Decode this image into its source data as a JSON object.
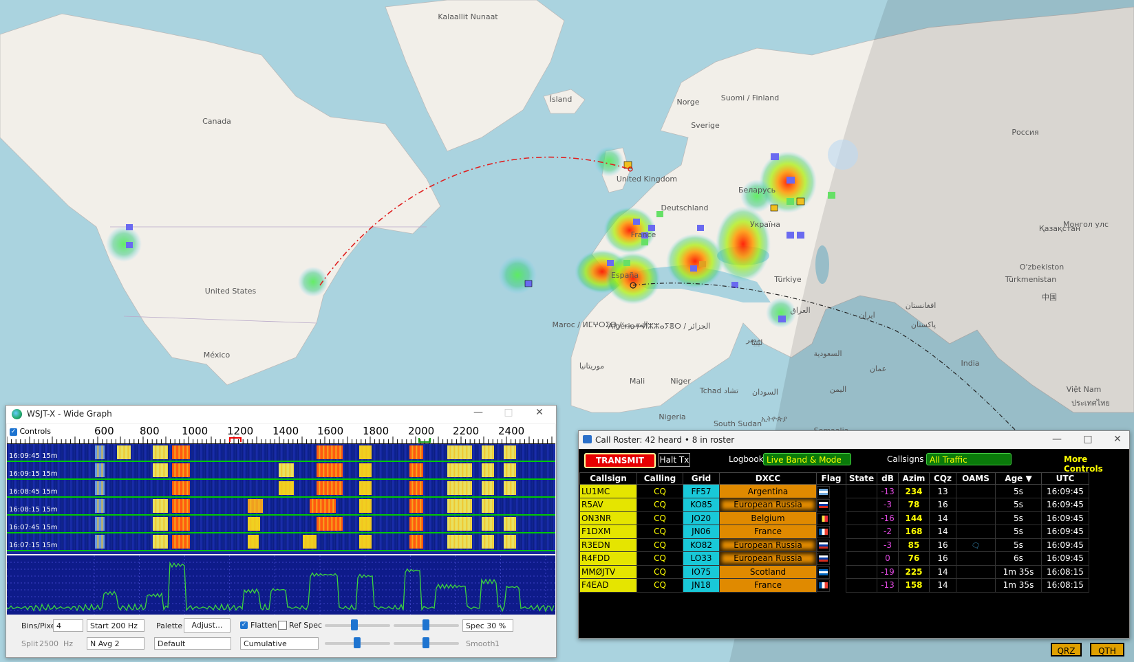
{
  "map": {
    "labels": [
      "Kalaallit Nunaat",
      "Ísland",
      "Canada",
      "Norge",
      "Suomi / Finland",
      "Sverige",
      "Россия",
      "United Kingdom",
      "Беларусь",
      "Deutschland",
      "Україна",
      "Қазақстан",
      "Монгол улс",
      "United States",
      "France",
      "España",
      "Türkiye",
      "O'zbekiston",
      "Türkmenistan",
      "Maroc / ⵍⵎⵖⵔⵉⴱ / المغرب",
      "Algérie / ⵍⵣⵣⴰⵢⴻⵔ / الجزائر",
      "ليبيا",
      "مصر",
      "العراق",
      "ایران",
      "افغانستان",
      "پاکستان",
      "India",
      "中国",
      "México",
      "موريتانيا",
      "Mali",
      "Niger",
      "Tchad تشاد",
      "السودان",
      "السعودية",
      "اليمن",
      "عمان",
      "Nigeria",
      "South Sudan",
      "ኢትዮጵያ",
      "Somaalia",
      "Việt Nam",
      "ประเทศไทย"
    ]
  },
  "widegraph": {
    "title": "WSJT-X - Wide Graph",
    "controls_label": "Controls",
    "scale": [
      "600",
      "800",
      "1000",
      "1200",
      "1400",
      "1600",
      "1800",
      "2000",
      "2200",
      "2400"
    ],
    "rows": [
      {
        "time": "16:09:45",
        "band": "15m"
      },
      {
        "time": "16:09:15",
        "band": "15m"
      },
      {
        "time": "16:08:45",
        "band": "15m"
      },
      {
        "time": "16:08:15",
        "band": "15m"
      },
      {
        "time": "16:07:45",
        "band": "15m"
      },
      {
        "time": "16:07:15",
        "band": "15m"
      }
    ],
    "bins_pixel_label": "Bins/Pixel",
    "bins_pixel_value": "4",
    "start_value": "Start 200 Hz",
    "split_label": "Split",
    "split_value": "2500",
    "split_unit": "Hz",
    "navg_value": "N Avg 2",
    "palette_label": "Palette",
    "adjust_label": "Adjust...",
    "palette_value": "Default",
    "flatten_label": "Flatten",
    "refspec_label": "Ref Spec",
    "cumulative_value": "Cumulative",
    "spec_value": "Spec 30 %",
    "smooth_label": "Smooth",
    "smooth_value": "1"
  },
  "roster": {
    "title": "Call Roster: 42 heard • 8 in roster",
    "transmit_label": "TRANSMIT",
    "halt_label": "Halt Tx",
    "logbook_label": "Logbook",
    "logbook_value": "Live Band & Mode",
    "callsigns_label": "Callsigns",
    "callsigns_value": "All Traffic",
    "more_controls": "More Controls",
    "columns": [
      "Callsign",
      "Calling",
      "Grid",
      "DXCC",
      "Flag",
      "State",
      "dB",
      "Azim",
      "CQz",
      "OAMS",
      "Age ▼",
      "UTC"
    ],
    "rows": [
      {
        "call": "LU1MC",
        "calling": "CQ",
        "grid": "FF57",
        "dxcc": "Argentina",
        "state": "",
        "db": "-13",
        "azim": "234",
        "cqz": "13",
        "oams": "",
        "age": "5s",
        "utc": "16:09:45"
      },
      {
        "call": "R5AV",
        "calling": "CQ",
        "grid": "KO85",
        "dxcc": "European Russia",
        "state": "",
        "db": "-3",
        "azim": "78",
        "cqz": "16",
        "oams": "",
        "age": "5s",
        "utc": "16:09:45"
      },
      {
        "call": "ON3NR",
        "calling": "CQ",
        "grid": "JO20",
        "dxcc": "Belgium",
        "state": "",
        "db": "-16",
        "azim": "144",
        "cqz": "14",
        "oams": "",
        "age": "5s",
        "utc": "16:09:45"
      },
      {
        "call": "F1DXM",
        "calling": "CQ",
        "grid": "JN06",
        "dxcc": "France",
        "state": "",
        "db": "-2",
        "azim": "168",
        "cqz": "14",
        "oams": "",
        "age": "5s",
        "utc": "16:09:45"
      },
      {
        "call": "R3EDN",
        "calling": "CQ",
        "grid": "KO82",
        "dxcc": "European Russia",
        "state": "",
        "db": "-3",
        "azim": "85",
        "cqz": "16",
        "oams": "",
        "age": "5s",
        "utc": "16:09:45"
      },
      {
        "call": "R4FDD",
        "calling": "CQ",
        "grid": "LO33",
        "dxcc": "European Russia",
        "state": "",
        "db": "0",
        "azim": "76",
        "cqz": "16",
        "oams": "",
        "age": "6s",
        "utc": "16:09:45"
      },
      {
        "call": "MMØJTV",
        "calling": "CQ",
        "grid": "IO75",
        "dxcc": "Scotland",
        "state": "",
        "db": "-19",
        "azim": "225",
        "cqz": "14",
        "oams": "",
        "age": "1m 35s",
        "utc": "16:08:15"
      },
      {
        "call": "F4EAD",
        "calling": "CQ",
        "grid": "JN18",
        "dxcc": "France",
        "state": "",
        "db": "-13",
        "azim": "158",
        "cqz": "14",
        "oams": "",
        "age": "1m 35s",
        "utc": "16:08:15"
      }
    ]
  },
  "bottom_buttons": [
    "QRZ",
    "QTH"
  ]
}
